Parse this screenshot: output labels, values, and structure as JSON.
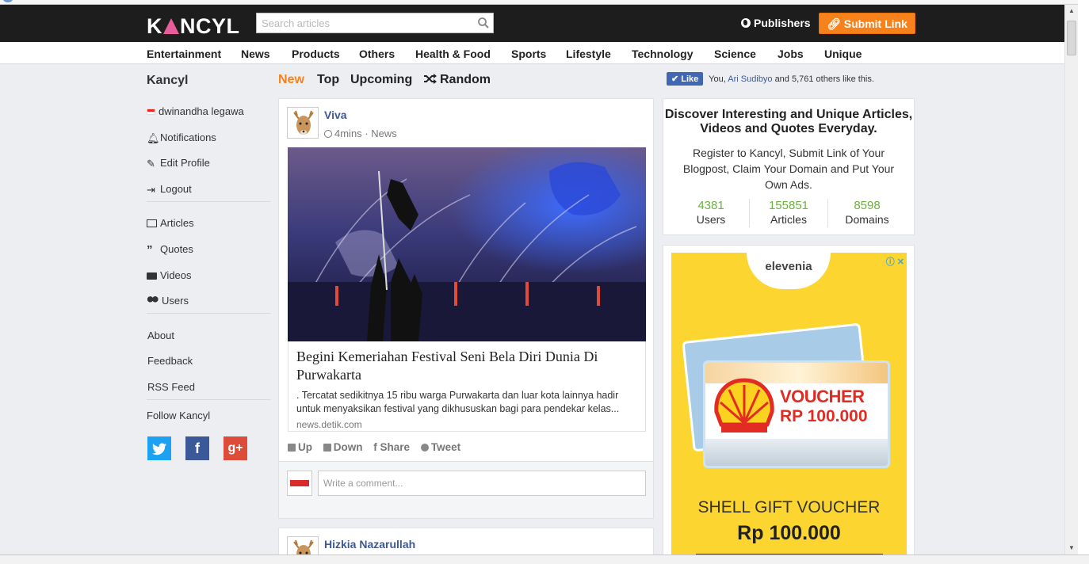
{
  "header": {
    "logo": "KANCYL",
    "search_placeholder": "Search articles",
    "publishers_label": "Publishers",
    "submit_label": "Submit Link"
  },
  "categories": [
    "Entertainment",
    "News",
    "Products",
    "Others",
    "Health & Food",
    "Sports",
    "Lifestyle",
    "Technology",
    "Science",
    "Jobs",
    "Unique"
  ],
  "sidebar": {
    "title": "Kancyl",
    "user_name": "dwinandha legawa",
    "items": [
      {
        "label": "Notifications",
        "icon": "bell-icon"
      },
      {
        "label": "Edit Profile",
        "icon": "edit-icon"
      },
      {
        "label": "Logout",
        "icon": "logout-icon"
      },
      {
        "label": "Articles",
        "icon": "newspaper-icon"
      },
      {
        "label": "Quotes",
        "icon": "quote-icon"
      },
      {
        "label": "Videos",
        "icon": "video-camera-icon"
      },
      {
        "label": "Users",
        "icon": "users-icon"
      }
    ],
    "links": [
      "About",
      "Feedback",
      "RSS Feed"
    ],
    "follow_label": "Follow Kancyl",
    "social": [
      {
        "name": "twitter",
        "glyph": "t",
        "color": "#1da1f2"
      },
      {
        "name": "facebook",
        "glyph": "f",
        "color": "#3b5998"
      },
      {
        "name": "google-plus",
        "glyph": "g+",
        "color": "#dd4b39"
      }
    ]
  },
  "feed_tabs": [
    {
      "label": "New",
      "active": true
    },
    {
      "label": "Top",
      "active": false
    },
    {
      "label": "Upcoming",
      "active": false
    },
    {
      "label": "Random",
      "active": false
    }
  ],
  "like_bar": {
    "button": "Like",
    "you": "You,",
    "friend": "Ari Sudibyo",
    "rest": "and 5,761 others like this."
  },
  "post": {
    "author": "Viva",
    "time": "4mins",
    "separator": "·",
    "category": "News",
    "title": "Begini Kemeriahan Festival Seni Bela Diri Dunia Di Purwakarta",
    "excerpt": ". Tercatat sedikitnya 15 ribu warga Purwakarta dan luar kota lainnya hadir untuk menyaksikan festival yang dikhususkan bagi para pendekar kelas...",
    "source": "news.detik.com",
    "actions": {
      "up": "Up",
      "down": "Down",
      "share": "Share",
      "tweet": "Tweet"
    },
    "comment_placeholder": "Write a comment..."
  },
  "post2": {
    "author": "Hizkia Nazarullah"
  },
  "discover": {
    "title": "Discover Interesting and Unique Articles, Videos and Quotes Everyday.",
    "text": "Register to Kancyl, Submit Link of Your Blogpost, Claim Your Domain and Put Your Own Ads.",
    "stats": [
      {
        "value": "4381",
        "label": "Users"
      },
      {
        "value": "155851",
        "label": "Articles"
      },
      {
        "value": "8598",
        "label": "Domains"
      }
    ]
  },
  "ad": {
    "brand": "elevenia",
    "voucher_label": "VOUCHER",
    "voucher_amount": "RP 100.000",
    "headline": "SHELL GIFT VOUCHER",
    "price": "Rp 100.000"
  },
  "colors": {
    "accent": "#f7821b",
    "link": "#3b5998",
    "stat": "#6db03f",
    "header_bg": "#1d1d1d"
  }
}
